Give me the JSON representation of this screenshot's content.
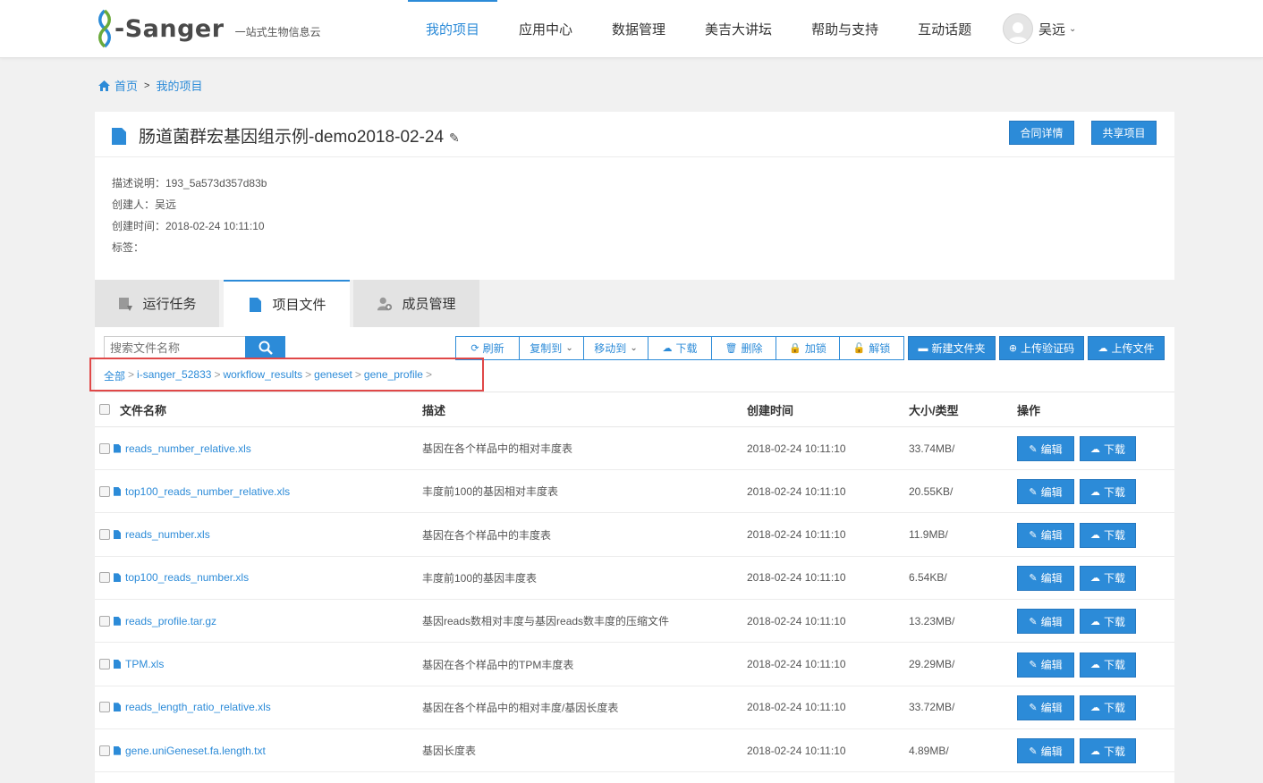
{
  "brand": {
    "name": "-Sanger",
    "tagline": "一站式生物信息云"
  },
  "nav": [
    {
      "label": "我的项目",
      "active": true
    },
    {
      "label": "应用中心"
    },
    {
      "label": "数据管理"
    },
    {
      "label": "美吉大讲坛"
    },
    {
      "label": "帮助与支持"
    },
    {
      "label": "互动话题"
    }
  ],
  "user": {
    "name": "吴远"
  },
  "breadcrumb": {
    "home": "首页",
    "current": "我的项目"
  },
  "project": {
    "title": "肠道菌群宏基因组示例-demo2018-02-24",
    "contract_button": "合同详情",
    "share_button": "共享项目",
    "description": "描述说明：193_5a573d357d83b",
    "creator": "创建人：吴远",
    "created": "创建时间：2018-02-24 10:11:10",
    "tags": "标签："
  },
  "tabs": [
    {
      "label": "运行任务"
    },
    {
      "label": "项目文件",
      "active": true
    },
    {
      "label": "成员管理"
    }
  ],
  "toolbar": {
    "search_placeholder": "搜索文件名称",
    "refresh": "刷新",
    "copy_to": "复制到",
    "move_to": "移动到",
    "download": "下载",
    "delete": "删除",
    "lock": "加锁",
    "unlock": "解锁",
    "new_folder": "新建文件夹",
    "upload_code": "上传验证码",
    "upload_file": "上传文件"
  },
  "path": {
    "segments": [
      "全部",
      "i-sanger_52833",
      "workflow_results",
      "geneset",
      "gene_profile"
    ],
    "separator": ">"
  },
  "table": {
    "headers": {
      "name": "文件名称",
      "desc": "描述",
      "created": "创建时间",
      "size": "大小/类型",
      "ops": "操作"
    },
    "edit_label": "编辑",
    "download_label": "下载",
    "rows": [
      {
        "name": "reads_number_relative.xls",
        "desc": "基因在各个样品中的相对丰度表",
        "created": "2018-02-24 10:11:10",
        "size": "33.74MB/"
      },
      {
        "name": "top100_reads_number_relative.xls",
        "desc": "丰度前100的基因相对丰度表",
        "created": "2018-02-24 10:11:10",
        "size": "20.55KB/"
      },
      {
        "name": "reads_number.xls",
        "desc": "基因在各个样品中的丰度表",
        "created": "2018-02-24 10:11:10",
        "size": "11.9MB/"
      },
      {
        "name": "top100_reads_number.xls",
        "desc": "丰度前100的基因丰度表",
        "created": "2018-02-24 10:11:10",
        "size": "6.54KB/"
      },
      {
        "name": "reads_profile.tar.gz",
        "desc": "基因reads数相对丰度与基因reads数丰度的压缩文件",
        "created": "2018-02-24 10:11:10",
        "size": "13.23MB/"
      },
      {
        "name": "TPM.xls",
        "desc": "基因在各个样品中的TPM丰度表",
        "created": "2018-02-24 10:11:10",
        "size": "29.29MB/"
      },
      {
        "name": "reads_length_ratio_relative.xls",
        "desc": "基因在各个样品中的相对丰度/基因长度表",
        "created": "2018-02-24 10:11:10",
        "size": "33.72MB/"
      },
      {
        "name": "gene.uniGeneset.fa.length.txt",
        "desc": "基因长度表",
        "created": "2018-02-24 10:11:10",
        "size": "4.89MB/"
      }
    ]
  },
  "colors": {
    "accent": "#2c8bd8",
    "highlight": "#e04848"
  }
}
